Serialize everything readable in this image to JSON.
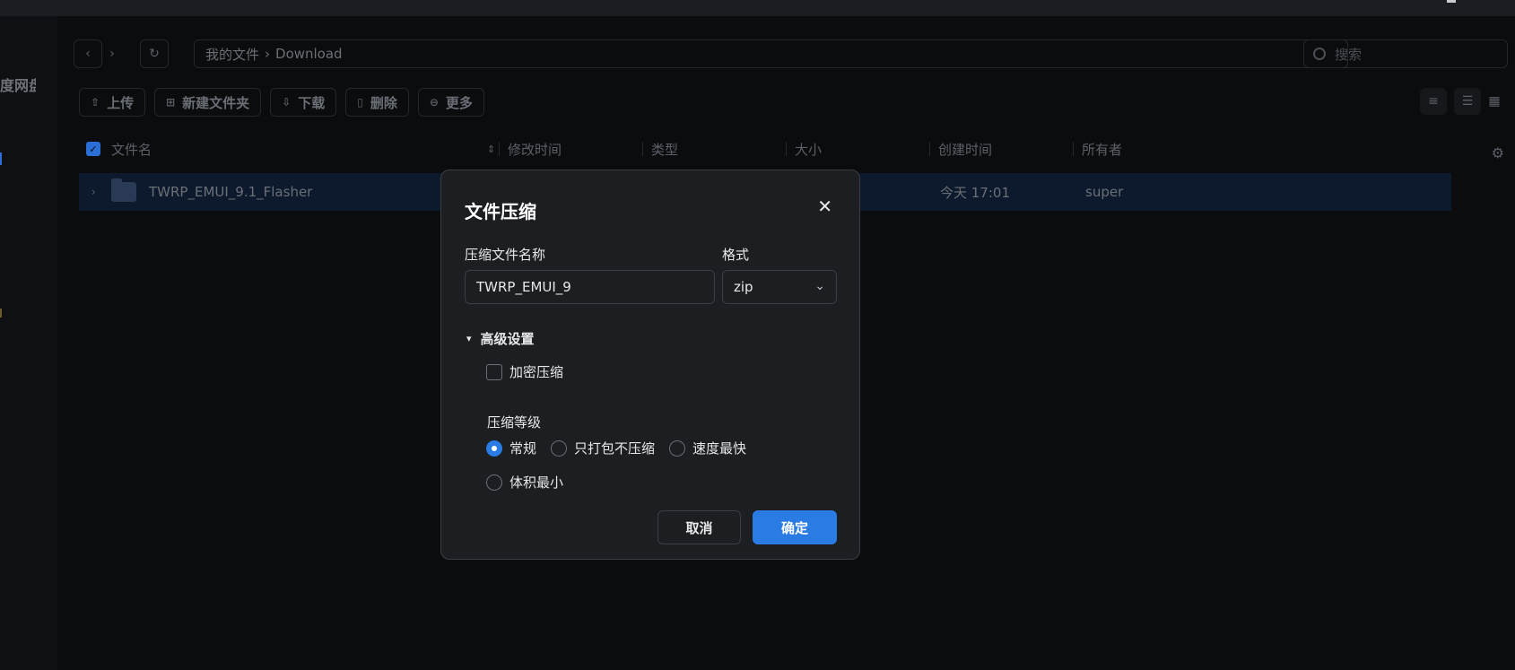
{
  "sidebar": {
    "brand": "度网盘"
  },
  "path": {
    "root": "我的文件",
    "separator": "›",
    "current": "Download"
  },
  "search": {
    "placeholder": "搜索"
  },
  "toolbar": {
    "upload": "上传",
    "new_folder": "新建文件夹",
    "download": "下载",
    "delete": "删除",
    "more": "更多"
  },
  "table": {
    "columns": [
      "文件名",
      "修改时间",
      "类型",
      "大小",
      "创建时间",
      "所有者"
    ],
    "rows": [
      {
        "name": "TWRP_EMUI_9.1_Flasher",
        "created": "今天 17:01",
        "owner": "super"
      }
    ]
  },
  "dialog": {
    "title": "文件压缩",
    "name_label": "压缩文件名称",
    "name_value": "TWRP_EMUI_9",
    "format_label": "格式",
    "format_value": "zip",
    "advanced_label": "高级设置",
    "encrypt_label": "加密压缩",
    "level_label": "压缩等级",
    "levels": [
      "常规",
      "只打包不压缩",
      "速度最快",
      "体积最小"
    ],
    "selected_level": "常规",
    "cancel": "取消",
    "confirm": "确定"
  },
  "colors": {
    "accent": "#2a7be4",
    "selected_row": "#0d1a2e",
    "dialog_bg": "#1c1e22"
  }
}
